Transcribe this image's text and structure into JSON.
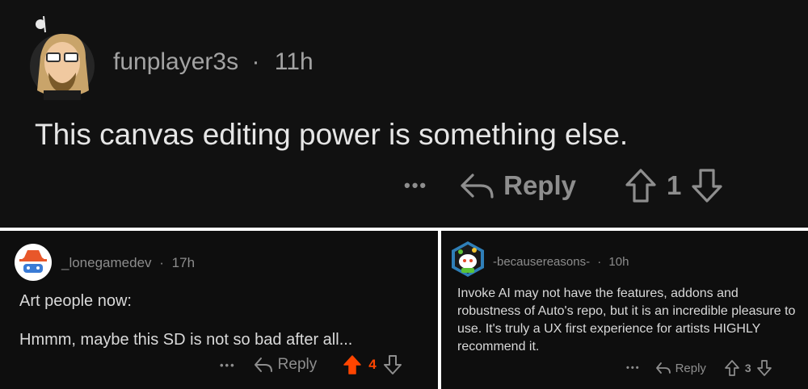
{
  "main_comment": {
    "username": "funplayer3s",
    "time": "11h",
    "body": "This canvas editing power is something else.",
    "more_label": "•••",
    "reply_label": "Reply",
    "vote_count": "1"
  },
  "left_comment": {
    "username": "_lonegamedev",
    "time": "17h",
    "body_lines": [
      "Art people now:",
      "Hmmm, maybe this SD is not so bad after all..."
    ],
    "more_label": "•••",
    "reply_label": "Reply",
    "vote_count": "4",
    "upvoted": true
  },
  "right_comment": {
    "username": "-becausereasons-",
    "time": "10h",
    "body": "Invoke AI may not have the features, addons and robustness of Auto's repo, but it is an incredible pleasure to use. It's truly a UX first experience for artists HIGHLY recommend it.",
    "more_label": "•••",
    "reply_label": "Reply",
    "vote_count": "3"
  },
  "colors": {
    "background": "#111111",
    "muted_text": "#8c8c8c",
    "upvote_active": "#ff4500"
  },
  "icons": [
    "avatar-icon",
    "reply-arrow-icon",
    "upvote-icon",
    "downvote-icon"
  ],
  "separator": "·"
}
